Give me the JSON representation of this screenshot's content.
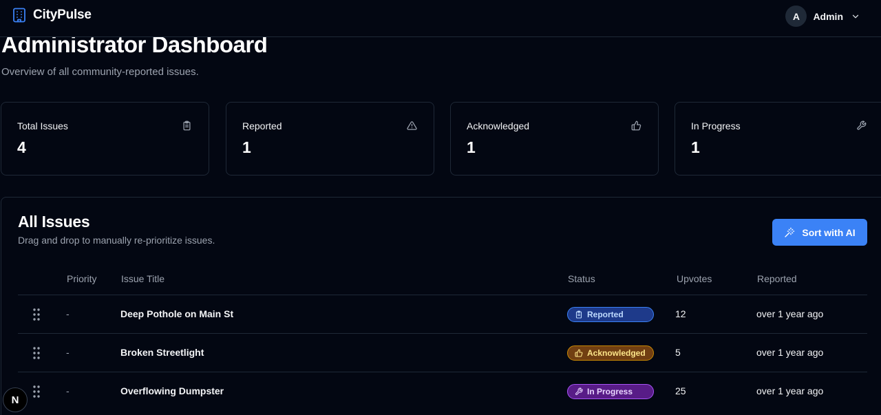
{
  "app": {
    "name": "CityPulse"
  },
  "user": {
    "initial": "A",
    "name": "Admin"
  },
  "page": {
    "title": "Administrator Dashboard",
    "subtitle": "Overview of all community-reported issues."
  },
  "stats": [
    {
      "label": "Total Issues",
      "value": "4",
      "icon": "clipboard-icon"
    },
    {
      "label": "Reported",
      "value": "1",
      "icon": "warning-icon"
    },
    {
      "label": "Acknowledged",
      "value": "1",
      "icon": "thumbs-up-icon"
    },
    {
      "label": "In Progress",
      "value": "1",
      "icon": "wrench-icon"
    }
  ],
  "issues_panel": {
    "title": "All Issues",
    "description": "Drag and drop to manually re-prioritize issues.",
    "sort_button": "Sort with AI",
    "columns": [
      "Priority",
      "Issue Title",
      "Status",
      "Upvotes",
      "Reported"
    ],
    "rows": [
      {
        "priority": "-",
        "title": "Deep Pothole on Main St",
        "status": "Reported",
        "upvotes": "12",
        "reported": "over 1 year ago"
      },
      {
        "priority": "-",
        "title": "Broken Streetlight",
        "status": "Acknowledged",
        "upvotes": "5",
        "reported": "over 1 year ago"
      },
      {
        "priority": "-",
        "title": "Overflowing Dumpster",
        "status": "In Progress",
        "upvotes": "25",
        "reported": "over 1 year ago"
      }
    ]
  },
  "dev_badge": {
    "label": "N"
  },
  "colors": {
    "background": "#030712",
    "border": "#1f2937",
    "accent": "#3b82f6",
    "status_reported_bg": "#1e3a8a",
    "status_acknowledged_bg": "#713f12",
    "status_in_progress_bg": "#581c87"
  }
}
